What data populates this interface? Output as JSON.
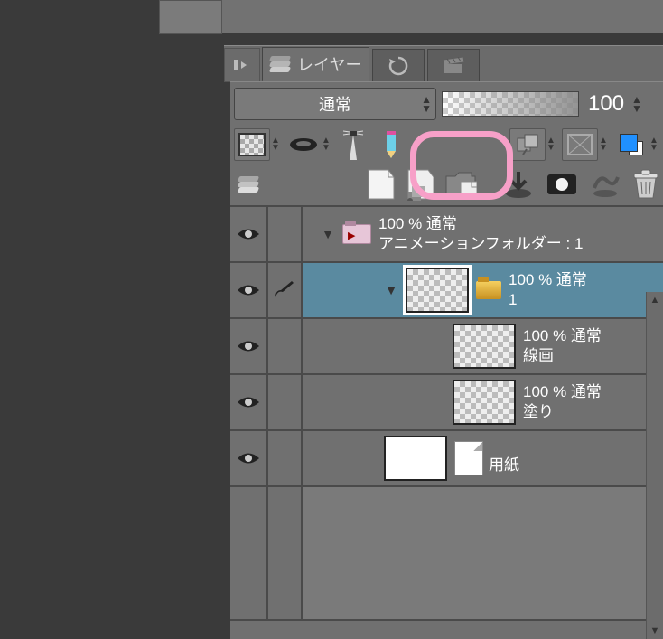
{
  "tabs": {
    "layers_label": "レイヤー"
  },
  "blend": {
    "mode": "通常",
    "opacity": "100"
  },
  "layers": {
    "anim_folder": {
      "opacity_mode": "100 % 通常",
      "name": "アニメーションフォルダー : 1"
    },
    "cel1": {
      "opacity_mode": "100 % 通常",
      "name": "1"
    },
    "line": {
      "opacity_mode": "100 % 通常",
      "name": "線画"
    },
    "paint": {
      "opacity_mode": "100 % 通常",
      "name": "塗り"
    },
    "paper": {
      "name": "用紙"
    }
  }
}
